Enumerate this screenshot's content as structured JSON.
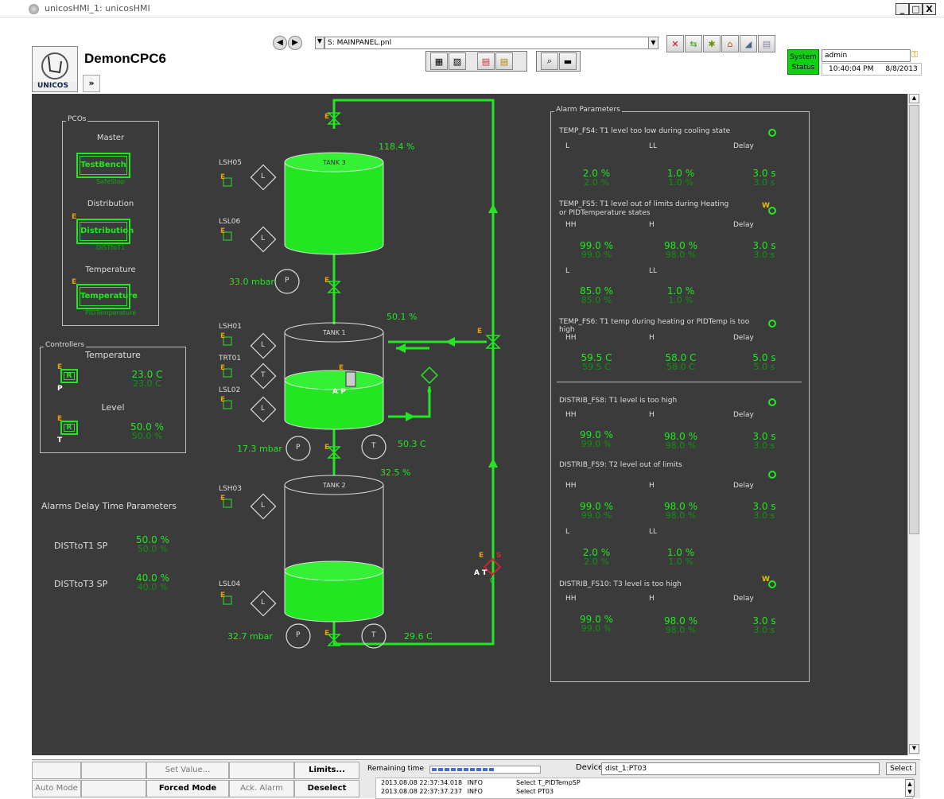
{
  "window": {
    "title": "unicosHMI_1: unicosHMI",
    "min": "_",
    "max": "□",
    "close": "X"
  },
  "header": {
    "app_name": "DemonCPC6",
    "logo_text": "UNICOS",
    "expand": "»",
    "panel_path": "S: MAINPANEL.pnl",
    "system_status": "System\nStatus",
    "user": "admin",
    "time": "10:40:04 PM",
    "date": "8/8/2013"
  },
  "pcos": {
    "legend": "PCOs",
    "items": [
      {
        "group": "Master",
        "button": "TestBench",
        "sub": "SafeStop",
        "e": ""
      },
      {
        "group": "Distribution",
        "button": "Distribution",
        "sub": "DISTtoT1",
        "e": "E"
      },
      {
        "group": "Temperature",
        "button": "Temperature",
        "sub": "PIDTemperature",
        "e": "E"
      }
    ]
  },
  "controllers": {
    "legend": "Controllers",
    "items": [
      {
        "title": "Temperature",
        "label": "R",
        "e": "E",
        "letter": "P",
        "v1": "23.0 C",
        "v2": "23.0 C"
      },
      {
        "title": "Level",
        "label": "R",
        "e": "E",
        "letter": "T",
        "v1": "50.0 %",
        "v2": "50.0 %"
      }
    ]
  },
  "alarm_delay": {
    "title": "Alarms Delay Time Parameters",
    "items": [
      {
        "label": "DISTtoT1 SP",
        "v1": "50.0 %",
        "v2": "50.0 %"
      },
      {
        "label": "DISTtoT3 SP",
        "v1": "40.0 %",
        "v2": "40.0 %"
      }
    ]
  },
  "process": {
    "tank3": "TANK 3",
    "tank1": "TANK 1",
    "tank2": "TANK 2",
    "tank3_level": "118.4 %",
    "tank1_level": "50.1 %",
    "tank2_level": "32.5 %",
    "p3": "33.0 mbar",
    "p1": "17.3 mbar",
    "p2": "32.7 mbar",
    "t1": "50.3 C",
    "t2": "29.6 C",
    "LSH05": "LSH05",
    "LSL06": "LSL06",
    "LSH01": "LSH01",
    "TRT01": "TRT01",
    "LSL02": "LSL02",
    "LSH03": "LSH03",
    "LSL04": "LSL04",
    "L": "L",
    "T": "T",
    "P": "P",
    "E": "E",
    "S": "S",
    "ap": "A P",
    "at": "A T",
    "zero": "0"
  },
  "alarms": {
    "legend": "Alarm Parameters",
    "blocks": [
      {
        "title": "TEMP_FS4: T1 level too low during cooling state",
        "flag": "",
        "rows": [
          {
            "h": [
              "L",
              "LL",
              "Delay"
            ],
            "v": [
              [
                "2.0 %",
                "2.0 %"
              ],
              [
                "1.0 %",
                "1.0 %"
              ],
              [
                "3.0 s",
                "3.0 s"
              ]
            ]
          }
        ]
      },
      {
        "title": "TEMP_FS5: T1 level out of limits during Heating or PIDTemperature states",
        "flag": "W",
        "rows": [
          {
            "h": [
              "HH",
              "H",
              "Delay"
            ],
            "v": [
              [
                "99.0 %",
                "99.0 %"
              ],
              [
                "98.0 %",
                "98.0 %"
              ],
              [
                "3.0 s",
                "3.0 s"
              ]
            ]
          },
          {
            "h": [
              "L",
              "LL",
              ""
            ],
            "v": [
              [
                "85.0 %",
                "85.0 %"
              ],
              [
                "1.0 %",
                "1.0 %"
              ],
              [
                "",
                ""
              ]
            ]
          }
        ]
      },
      {
        "title": "TEMP_FS6: T1 temp during heating or PIDTemp is too high",
        "flag": "",
        "rows": [
          {
            "h": [
              "HH",
              "H",
              "Delay"
            ],
            "v": [
              [
                "59.5 C",
                "59.5 C"
              ],
              [
                "58.0 C",
                "58.0 C"
              ],
              [
                "5.0 s",
                "5.0 s"
              ]
            ]
          }
        ]
      },
      {
        "title": "DISTRIB_FS8: T1 level is too high",
        "flag": "",
        "rows": [
          {
            "h": [
              "HH",
              "H",
              "Delay"
            ],
            "v": [
              [
                "99.0 %",
                "99.0 %"
              ],
              [
                "98.0 %",
                "98.0 %"
              ],
              [
                "3.0 s",
                "3.0 s"
              ]
            ]
          }
        ]
      },
      {
        "title": "DISTRIB_FS9: T2 level out of limits",
        "flag": "",
        "rows": [
          {
            "h": [
              "HH",
              "H",
              "Delay"
            ],
            "v": [
              [
                "99.0 %",
                "99.0 %"
              ],
              [
                "98.0 %",
                "98.0 %"
              ],
              [
                "3.0 s",
                "3.0 s"
              ]
            ]
          },
          {
            "h": [
              "L",
              "LL",
              ""
            ],
            "v": [
              [
                "2.0 %",
                "2.0 %"
              ],
              [
                "1.0 %",
                "1.0 %"
              ],
              [
                "",
                ""
              ]
            ]
          }
        ]
      },
      {
        "title": "DISTRIB_FS10: T3 level is too high",
        "flag": "W",
        "rows": [
          {
            "h": [
              "HH",
              "H",
              "Delay"
            ],
            "v": [
              [
                "99.0 %",
                "99.0 %"
              ],
              [
                "98.0 %",
                "98.0 %"
              ],
              [
                "3.0 s",
                "3.0 s"
              ]
            ]
          }
        ]
      }
    ]
  },
  "bottom": {
    "buttons_row1": [
      "",
      "",
      "Set Value...",
      "",
      "Limits..."
    ],
    "buttons_row2": [
      "Auto Mode",
      "",
      "Forced Mode",
      "Ack. Alarm",
      "Deselect"
    ],
    "remaining": "Remaining time",
    "device_label": "Device",
    "device_value": "dist_1:PT03",
    "select": "Select",
    "log": [
      {
        "time": "2013.08.08 22:37:34.018",
        "level": "INFO",
        "msg": "Select T_PIDTempSP"
      },
      {
        "time": "2013.08.08 22:37:37.237",
        "level": "INFO",
        "msg": "Select PT03"
      }
    ]
  }
}
